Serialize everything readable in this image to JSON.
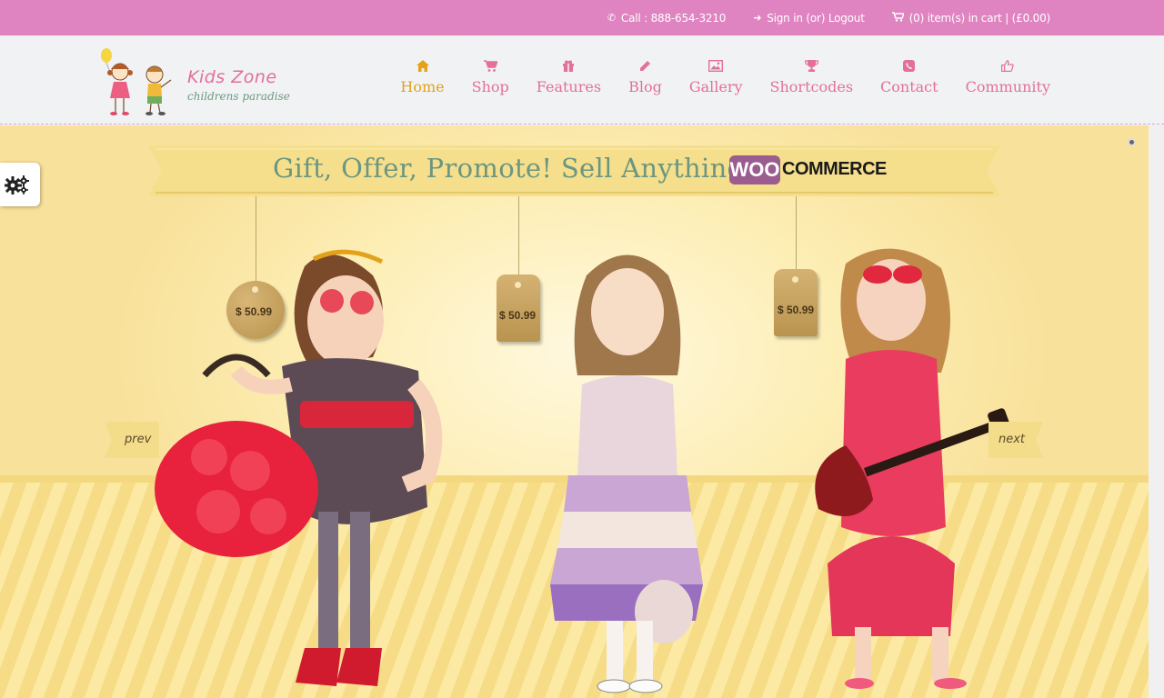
{
  "topbar": {
    "call": "Call : 888-654-3210",
    "signin": "Sign in (or) Logout",
    "cart": "(0) item(s) in cart | (£0.00)"
  },
  "logo": {
    "title": "Kids Zone",
    "subtitle": "childrens paradise"
  },
  "nav": [
    {
      "label": "Home",
      "icon": "home-icon",
      "active": true
    },
    {
      "label": "Shop",
      "icon": "cart-icon"
    },
    {
      "label": "Features",
      "icon": "gift-icon"
    },
    {
      "label": "Blog",
      "icon": "pencil-icon"
    },
    {
      "label": "Gallery",
      "icon": "image-icon"
    },
    {
      "label": "Shortcodes",
      "icon": "trophy-icon"
    },
    {
      "label": "Contact",
      "icon": "phone-icon"
    },
    {
      "label": "Community",
      "icon": "thumbs-up-icon"
    }
  ],
  "hero": {
    "headline": "Gift, Offer, Promote! Sell Anything",
    "woo_badge": "WOO",
    "woo_text": "COMMERCE",
    "prices": [
      "$ 50.99",
      "$ 50.99",
      "$ 50.99"
    ],
    "prev": "prev",
    "next": "next"
  },
  "colors": {
    "topbar": "#df84c0",
    "nav_link": "#e46f9c",
    "nav_active": "#e3a21a",
    "headline": "#6b9680"
  }
}
